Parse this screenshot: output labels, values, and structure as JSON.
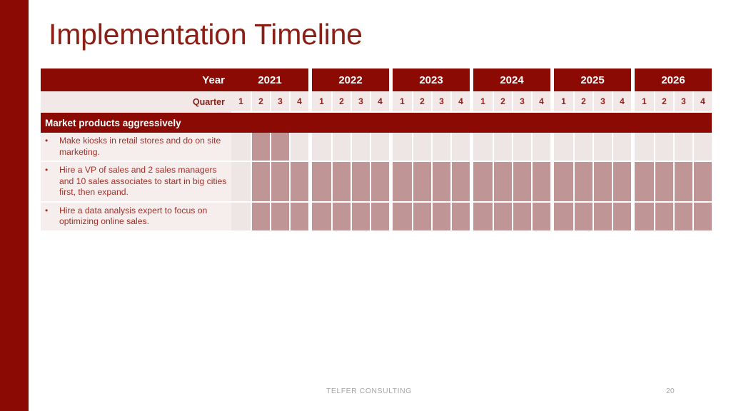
{
  "slide": {
    "title": "Implementation Timeline",
    "accent_color": "#8b0a04",
    "title_color": "#8b1f16",
    "fill_color": "#c09595",
    "empty_color": "#eee5e5"
  },
  "table": {
    "year_header_label": "Year",
    "quarter_header_label": "Quarter",
    "years": [
      "2021",
      "2022",
      "2023",
      "2024",
      "2025",
      "2026"
    ],
    "quarters": [
      "1",
      "2",
      "3",
      "4"
    ],
    "section": {
      "title": "Market products aggressively"
    },
    "tasks": [
      {
        "bullet": "•",
        "text": "Make kiosks in retail stores and do on site marketing.",
        "filled": [
          [
            false,
            true,
            true,
            false
          ],
          [
            false,
            false,
            false,
            false
          ],
          [
            false,
            false,
            false,
            false
          ],
          [
            false,
            false,
            false,
            false
          ],
          [
            false,
            false,
            false,
            false
          ],
          [
            false,
            false,
            false,
            false
          ]
        ]
      },
      {
        "bullet": "•",
        "text": "Hire a VP of sales and 2 sales managers and 10 sales associates to start in big cities first, then expand.",
        "filled": [
          [
            false,
            true,
            true,
            true
          ],
          [
            true,
            true,
            true,
            true
          ],
          [
            true,
            true,
            true,
            true
          ],
          [
            true,
            true,
            true,
            true
          ],
          [
            true,
            true,
            true,
            true
          ],
          [
            true,
            true,
            true,
            true
          ]
        ]
      },
      {
        "bullet": "•",
        "text": "Hire a data analysis expert to focus on optimizing online sales.",
        "filled": [
          [
            false,
            true,
            true,
            true
          ],
          [
            true,
            true,
            true,
            true
          ],
          [
            true,
            true,
            true,
            true
          ],
          [
            true,
            true,
            true,
            true
          ],
          [
            true,
            true,
            true,
            true
          ],
          [
            true,
            true,
            true,
            true
          ]
        ]
      }
    ]
  },
  "footer": {
    "organization": "TELFER CONSULTING",
    "page_number": "20"
  }
}
